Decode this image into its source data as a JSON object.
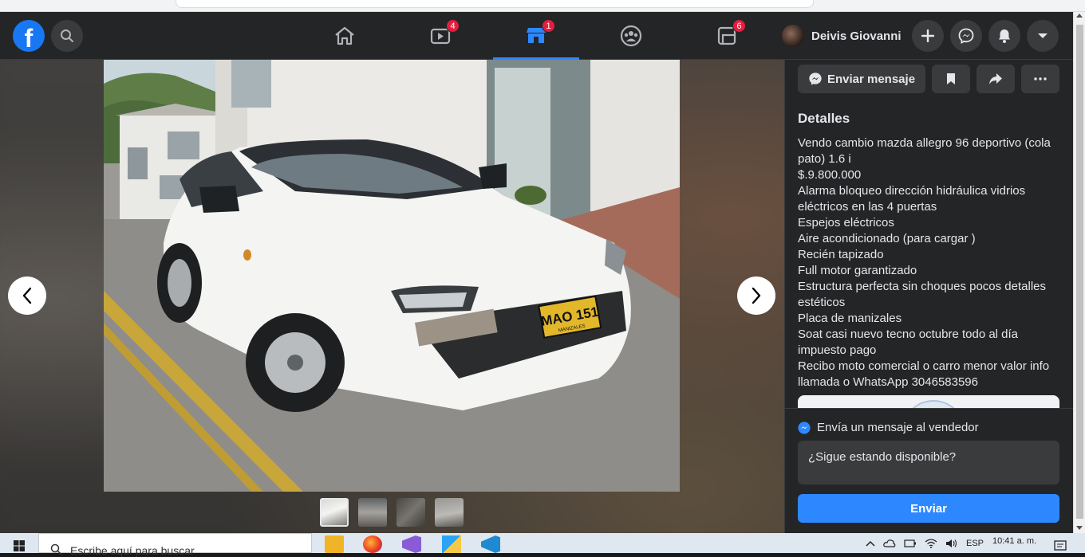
{
  "browser": {
    "chrome": ""
  },
  "header": {
    "logo": "f",
    "nav": [
      {
        "name": "home",
        "badge": ""
      },
      {
        "name": "watch",
        "badge": "4"
      },
      {
        "name": "marketplace",
        "badge": "1"
      },
      {
        "name": "groups",
        "badge": ""
      },
      {
        "name": "gaming",
        "badge": "6"
      }
    ],
    "profile_name": "Deivis Giovanni"
  },
  "viewer": {
    "plate_top": "MAO 151",
    "plate_bottom": "MANIZALES",
    "thumbnail_count": 4
  },
  "panel": {
    "send_message_label": "Enviar mensaje",
    "details_title": "Detalles",
    "details_lines": [
      "Vendo cambio mazda allegro 96 deportivo (cola pato) 1.6 i",
      "$.9.800.000",
      "Alarma bloqueo dirección hidráulica vidrios eléctricos en las 4 puertas",
      "Espejos eléctricos",
      "Aire acondicionado (para cargar )",
      "Recién tapizado",
      "Full motor garantizado",
      "Estructura perfecta sin choques pocos detalles estéticos",
      "Placa de manizales",
      "Soat casi nuevo tecno octubre todo al día impuesto pago",
      "Recibo moto comercial o carro menor valor info llamada o WhatsApp 3046583596"
    ],
    "seller_heading": "Envía un mensaje al vendedor",
    "message_value": "¿Sigue estando disponible?",
    "send_button": "Enviar"
  },
  "taskbar": {
    "search_placeholder": "Escribe aquí para buscar",
    "language": "ESP",
    "time": "10:41 a. m."
  },
  "colors": {
    "accent": "#2d88ff",
    "brand": "#1877f2",
    "badge": "#e41e3f",
    "surface": "#242526",
    "background": "#18191a"
  }
}
